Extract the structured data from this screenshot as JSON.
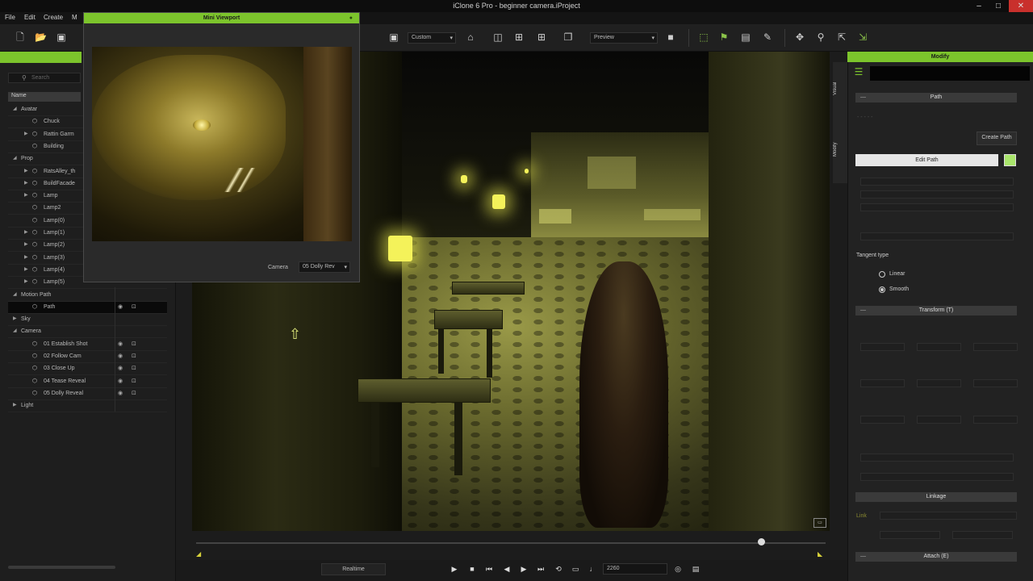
{
  "window": {
    "title": "iClone 6 Pro - beginner camera.iProject"
  },
  "menu": {
    "items": [
      "File",
      "Edit",
      "Create",
      "M"
    ]
  },
  "toolbar": {
    "view_dropdown": "Custom",
    "render_dropdown": "Preview"
  },
  "left_panel": {
    "search_placeholder": "Search",
    "column_header": "Name",
    "tree": [
      {
        "label": "Avatar",
        "level": 0,
        "expand": "open"
      },
      {
        "label": "Chuck",
        "level": 1,
        "expand": "none"
      },
      {
        "label": "Rattin Garm",
        "level": 1,
        "expand": "closed"
      },
      {
        "label": "Building",
        "level": 1,
        "expand": "none"
      },
      {
        "label": "Prop",
        "level": 0,
        "expand": "open"
      },
      {
        "label": "RatsAlley_th",
        "level": 1,
        "expand": "closed"
      },
      {
        "label": "BuildFacade",
        "level": 1,
        "expand": "closed"
      },
      {
        "label": "Lamp",
        "level": 1,
        "expand": "closed"
      },
      {
        "label": "Lamp2",
        "level": 1,
        "expand": "none"
      },
      {
        "label": "Lamp(0)",
        "level": 1,
        "expand": "none"
      },
      {
        "label": "Lamp(1)",
        "level": 1,
        "expand": "closed"
      },
      {
        "label": "Lamp(2)",
        "level": 1,
        "expand": "closed"
      },
      {
        "label": "Lamp(3)",
        "level": 1,
        "expand": "closed"
      },
      {
        "label": "Lamp(4)",
        "level": 1,
        "expand": "closed"
      },
      {
        "label": "Lamp(5)",
        "level": 1,
        "expand": "closed"
      },
      {
        "label": "Motion Path",
        "level": 0,
        "expand": "open"
      },
      {
        "label": "Path",
        "level": 1,
        "expand": "none",
        "selected": true
      },
      {
        "label": "Sky",
        "level": 0,
        "expand": "closed"
      },
      {
        "label": "Camera",
        "level": 0,
        "expand": "open"
      },
      {
        "label": "01 Establish Shot",
        "level": 1,
        "expand": "none"
      },
      {
        "label": "02 Follow Cam",
        "level": 1,
        "expand": "none"
      },
      {
        "label": "03 Close Up",
        "level": 1,
        "expand": "none"
      },
      {
        "label": "04 Tease Reveal",
        "level": 1,
        "expand": "none"
      },
      {
        "label": "05 Dolly Reveal",
        "level": 1,
        "expand": "none"
      },
      {
        "label": "Light",
        "level": 0,
        "expand": "closed"
      }
    ]
  },
  "mini_viewport": {
    "title": "Mini Viewport",
    "camera_label": "Camera",
    "camera_value": "05 Dolly Rev"
  },
  "timeline": {
    "realtime_label": "Realtime",
    "frame_value": "2260"
  },
  "right_panel": {
    "header": "Modify",
    "tabs": [
      "Modify",
      "Visual"
    ],
    "path_section": "Path",
    "create_path": "Create Path",
    "edit_path": "Edit Path",
    "tangent_type_label": "Tangent type",
    "tangent_options": [
      {
        "label": "Linear",
        "checked": false
      },
      {
        "label": "Smooth",
        "checked": true
      }
    ],
    "transform_section": "Transform (T)",
    "linkage_section": "Linkage",
    "link_label": "Link",
    "attach_section": "Attach (E)",
    "path_color": "#a9e56b"
  },
  "colors": {
    "accent": "#7cc42c"
  }
}
